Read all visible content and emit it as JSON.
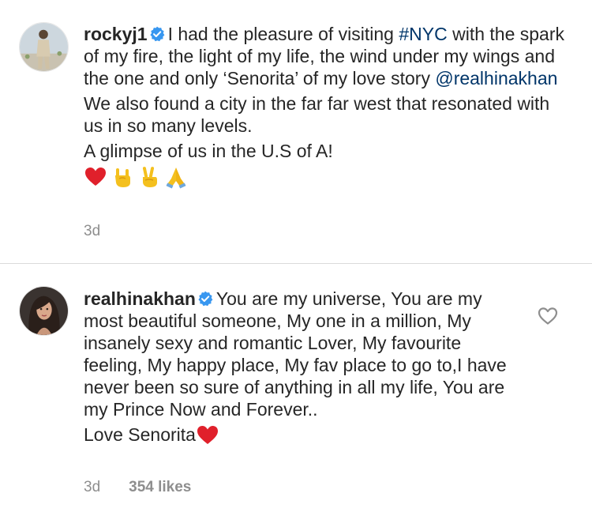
{
  "comments": [
    {
      "username": "rockyj1",
      "verified": true,
      "paragraphs": [
        {
          "parts": [
            "I had the pleasure of visiting ",
            "#NYC",
            " with the spark of my fire, the light of my life, the wind under my wings and the one and only ‘Senorita’ of my love story ",
            "@realhinakhan"
          ]
        },
        {
          "text": "We also found a city in the far far west that resonated with us in so many levels."
        },
        {
          "text": "A glimpse of us in the U.S of A!"
        }
      ],
      "emojis": [
        "red-heart-icon",
        "rock-on-hand-icon",
        "victory-hand-icon",
        "folded-hands-icon"
      ],
      "time": "3d"
    },
    {
      "username": "realhinakhan",
      "verified": true,
      "paragraphs": [
        {
          "text": "You are my universe, You are my most beautiful someone, My one in a million, My insanely sexy and romantic Lover, My favourite feeling, My happy place, My fav place to go to,I have never been so sure of anything in all my life, You are my Prince Now and Forever.."
        },
        {
          "text": "Love Senorita"
        }
      ],
      "time": "3d",
      "likes": "354 likes"
    }
  ],
  "colors": {
    "link": "#003569",
    "verified_blue": "#3897f0",
    "meta_gray": "#8e8e8e",
    "heart_red": "#e0202b",
    "divider": "#dbdbdb"
  }
}
